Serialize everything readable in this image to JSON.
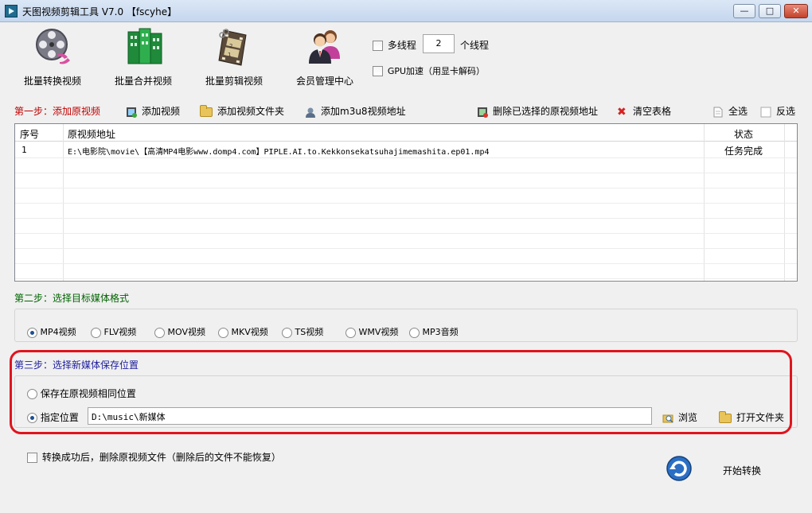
{
  "window": {
    "title": "天图视频剪辑工具 V7.0  【fscyhe】",
    "minimize_glyph": "—",
    "maximize_glyph": "□",
    "close_glyph": "✕"
  },
  "toolbar": {
    "batch_convert": "批量转换视频",
    "batch_merge": "批量合并视频",
    "batch_clip": "批量剪辑视频",
    "member_center": "会员管理中心"
  },
  "options": {
    "multithread_label": "多线程",
    "thread_count": "2",
    "thread_unit": "个线程",
    "gpu_label": "GPU加速（用显卡解码）"
  },
  "step1": {
    "title": "第一步：添加原视频",
    "add_video": "添加视频",
    "add_folder": "添加视频文件夹",
    "add_m3u8": "添加m3u8视频地址",
    "delete_selected": "删除已选择的原视频地址",
    "clear_table": "清空表格",
    "select_all": "全选",
    "invert_select": "反选"
  },
  "table": {
    "columns": [
      "序号",
      "原视频地址",
      "状态"
    ],
    "rows": [
      {
        "index": "1",
        "path": "E:\\电影院\\movie\\【高清MP4电影www.domp4.com】PIPLE.AI.to.Kekkonsekatsuhajimemashita.ep01.mp4",
        "status": "任务完成"
      }
    ]
  },
  "step2": {
    "title": "第二步：选择目标媒体格式",
    "formats": [
      "MP4视频",
      "FLV视频",
      "MOV视频",
      "MKV视频",
      "TS视频",
      "WMV视频",
      "MP3音频"
    ],
    "selected": "MP4视频"
  },
  "step3": {
    "title": "第三步：选择新媒体保存位置",
    "same_location": "保存在原视频相同位置",
    "specify_location": "指定位置",
    "path_value": "D:\\music\\新媒体",
    "browse": "浏览",
    "open_folder": "打开文件夹"
  },
  "footer": {
    "delete_after_convert": "转换成功后，删除原视频文件（删除后的文件不能恢复）",
    "start_convert": "开始转换"
  },
  "colors": {
    "step1": "#c00000",
    "step2": "#006400",
    "step3": "#1c1c9c",
    "highlight": "#e0141e"
  }
}
